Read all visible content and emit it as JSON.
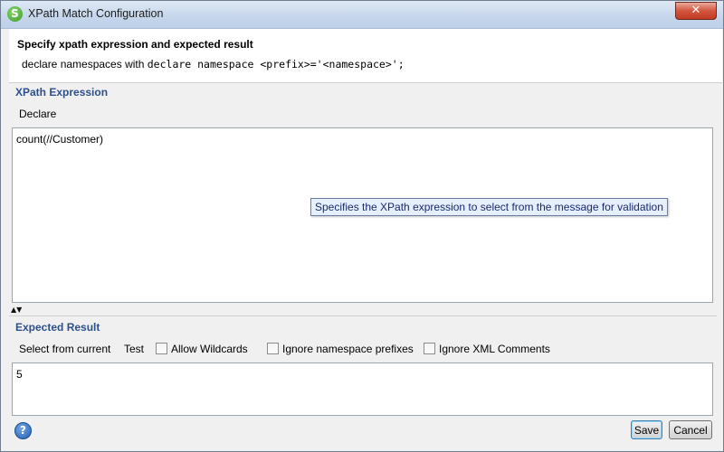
{
  "window": {
    "title": "XPath Match Configuration",
    "app_icon_glyph": "S",
    "close_glyph": "✕"
  },
  "header": {
    "title": "Specify xpath expression and expected result",
    "desc_prefix": "declare namespaces with ",
    "desc_code": "declare namespace <prefix>='<namespace>';"
  },
  "xpath": {
    "section_label": "XPath Expression",
    "declare_label": "Declare",
    "expression": "count(//Customer)",
    "tooltip": "Specifies the XPath expression to select from the message for validation"
  },
  "divider": {
    "arrows": "▲▼"
  },
  "expected": {
    "section_label": "Expected Result",
    "select_from_current": "Select from current",
    "test": "Test",
    "allow_wildcards": "Allow Wildcards",
    "ignore_namespace_prefixes": "Ignore namespace prefixes",
    "ignore_xml_comments": "Ignore XML Comments",
    "value": "5"
  },
  "footer": {
    "help_glyph": "?",
    "save": "Save",
    "cancel": "Cancel"
  },
  "colors": {
    "section_label": "#2d4f8a",
    "tooltip_bg": "#e6efff",
    "close_button": "#c13b22"
  },
  "icons": [
    "app-logo-icon",
    "close-icon",
    "expand-collapse-arrows-icon",
    "help-icon"
  ]
}
